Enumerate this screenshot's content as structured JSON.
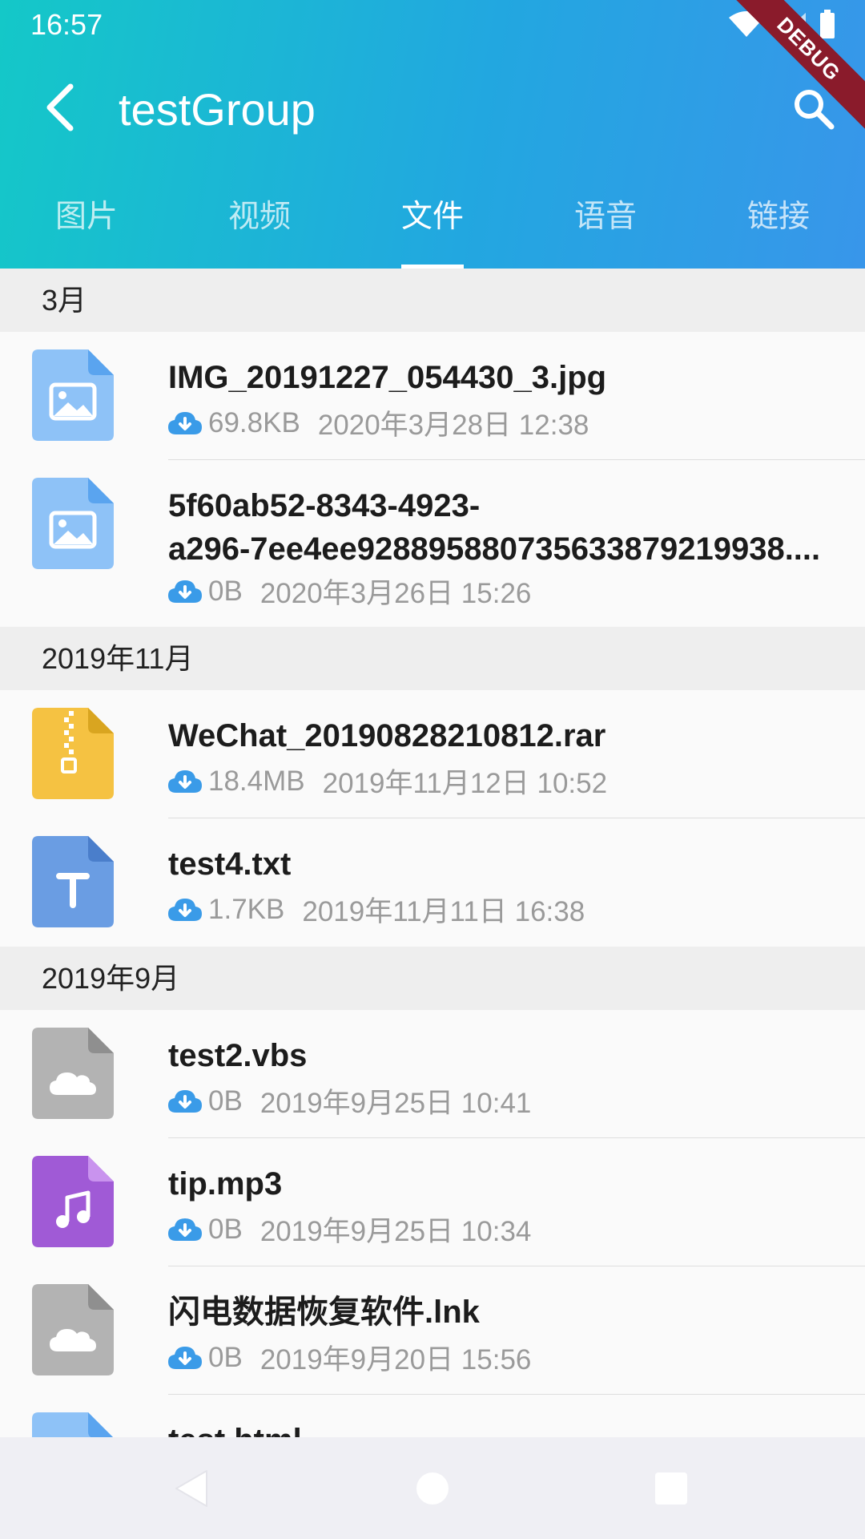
{
  "status_bar": {
    "time": "16:57",
    "debug_label": "DEBUG"
  },
  "app_bar": {
    "title": "testGroup"
  },
  "tabs": [
    {
      "label": "图片",
      "active": false
    },
    {
      "label": "视频",
      "active": false
    },
    {
      "label": "文件",
      "active": true
    },
    {
      "label": "语音",
      "active": false
    },
    {
      "label": "链接",
      "active": false
    }
  ],
  "sections": [
    {
      "header": "3月",
      "files": [
        {
          "name": "IMG_20191227_054430_3.jpg",
          "size": "69.8KB",
          "date": "2020年3月28日 12:38",
          "icon": "image-file-icon"
        },
        {
          "name_line1": "5f60ab52-8343-4923-",
          "name_line2": "a296-7ee4ee928895880735633879219938....",
          "size": "0B",
          "date": "2020年3月26日 15:26",
          "icon": "image-file-icon"
        }
      ]
    },
    {
      "header": "2019年11月",
      "files": [
        {
          "name": "WeChat_20190828210812.rar",
          "size": "18.4MB",
          "date": "2019年11月12日 10:52",
          "icon": "archive-file-icon"
        },
        {
          "name": "test4.txt",
          "size": "1.7KB",
          "date": "2019年11月11日 16:38",
          "icon": "text-file-icon"
        }
      ]
    },
    {
      "header": "2019年9月",
      "files": [
        {
          "name": "test2.vbs",
          "size": "0B",
          "date": "2019年9月25日 10:41",
          "icon": "unknown-file-icon"
        },
        {
          "name": "tip.mp3",
          "size": "0B",
          "date": "2019年9月25日 10:34",
          "icon": "audio-file-icon"
        },
        {
          "name": "闪电数据恢复软件.lnk",
          "size": "0B",
          "date": "2019年9月20日 15:56",
          "icon": "unknown-file-icon"
        },
        {
          "name": "test.html",
          "icon": "html-file-icon"
        }
      ]
    }
  ],
  "colors": {
    "header_start": "#14c8c8",
    "header_end": "#3896ea",
    "accent_blue": "#3a9be8",
    "image_icon": "#8ec2f7",
    "archive_icon": "#f5c242",
    "text_icon": "#6a9de3",
    "unknown_icon": "#b3b3b3",
    "audio_icon": "#a05ad6"
  }
}
